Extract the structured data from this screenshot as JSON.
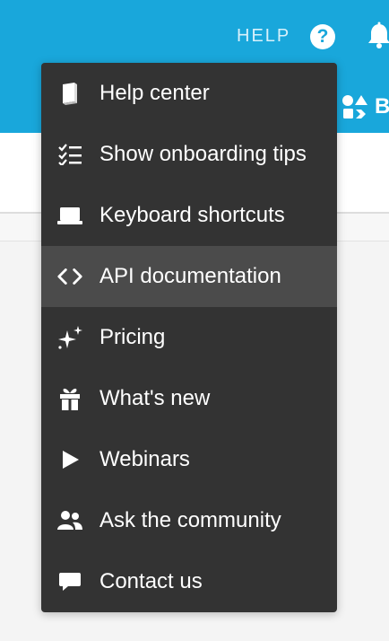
{
  "header": {
    "background_color": "#19a7db",
    "help_label": "HELP",
    "help_icon_glyph": "?",
    "apps_label": "B"
  },
  "icons": {
    "help": "question-circle-icon",
    "notifications": "bell-icon",
    "apps": "shapes-icon"
  },
  "menu": {
    "background_color": "#333333",
    "highlight_color": "#4b4b4b",
    "text_color": "#ffffff",
    "items": [
      {
        "label": "Help center",
        "icon": "book-icon"
      },
      {
        "label": "Show onboarding tips",
        "icon": "checklist-icon"
      },
      {
        "label": "Keyboard shortcuts",
        "icon": "laptop-icon"
      },
      {
        "label": "API documentation",
        "icon": "code-icon",
        "highlighted": true
      },
      {
        "label": "Pricing",
        "icon": "sparkle-icon"
      },
      {
        "label": "What's new",
        "icon": "gift-icon"
      },
      {
        "label": "Webinars",
        "icon": "play-icon"
      },
      {
        "label": "Ask the community",
        "icon": "users-icon"
      },
      {
        "label": "Contact us",
        "icon": "chat-bubble-icon"
      }
    ]
  }
}
